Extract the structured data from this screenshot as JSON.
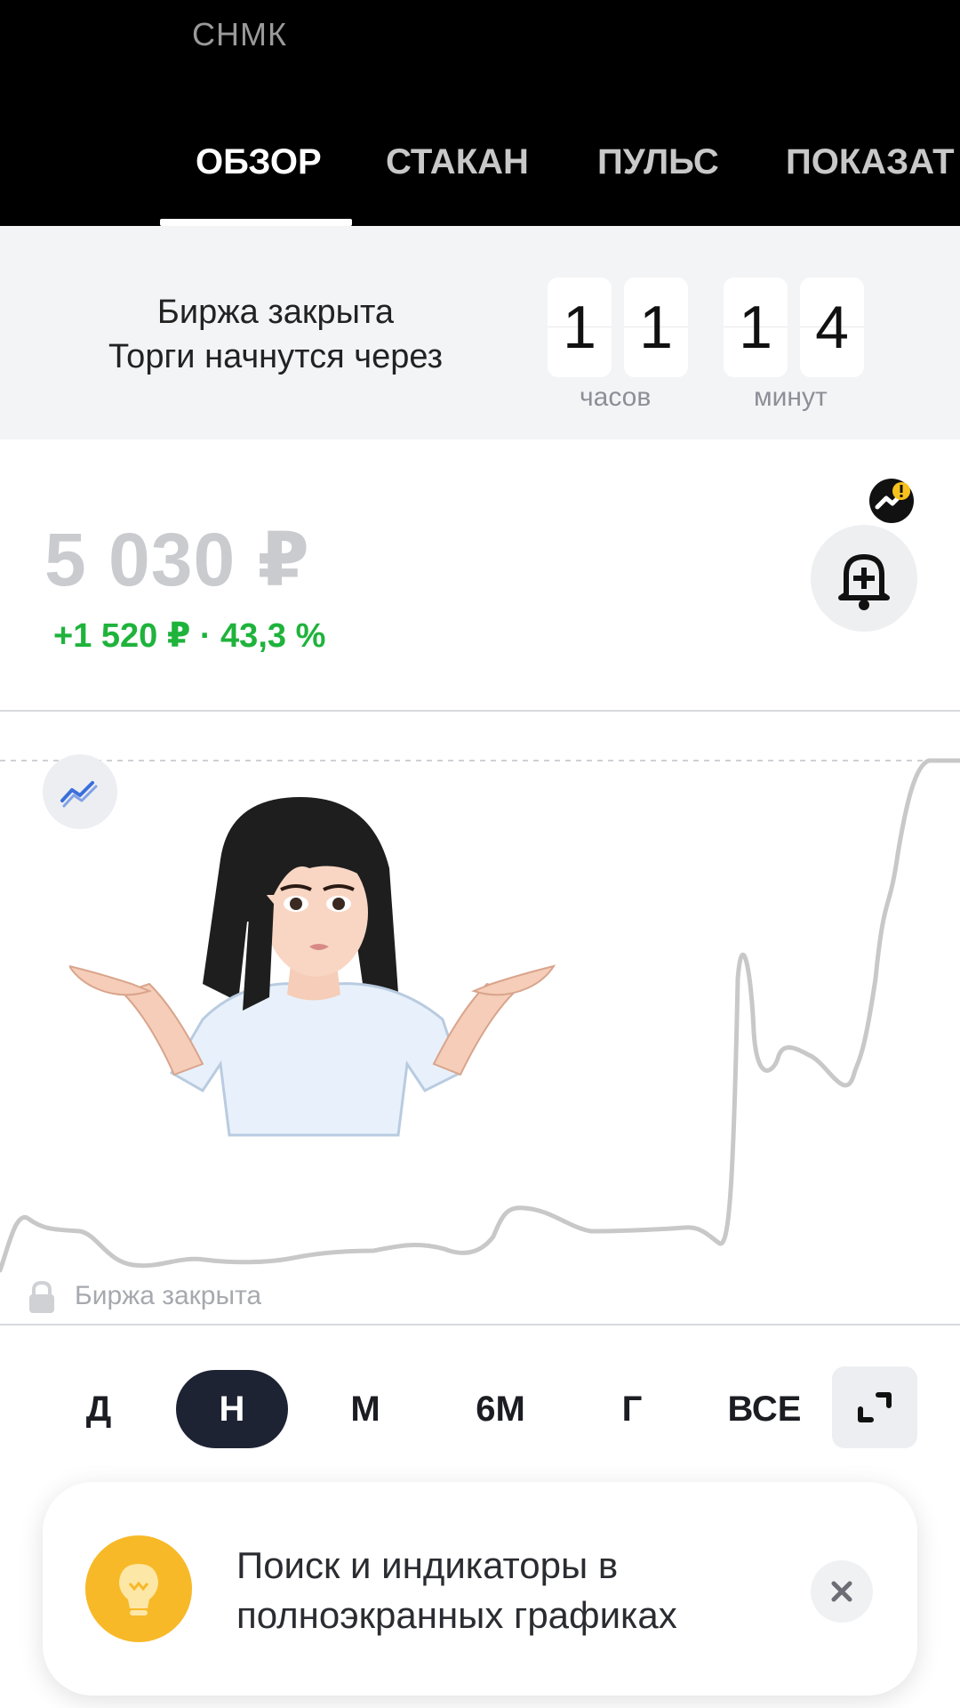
{
  "header": {
    "ticker": "СНМК",
    "tabs": [
      {
        "label": "ОБЗОР",
        "active": true
      },
      {
        "label": "СТАКАН",
        "active": false
      },
      {
        "label": "ПУЛЬС",
        "active": false
      },
      {
        "label": "ПОКАЗАТ",
        "active": false
      }
    ]
  },
  "exchange": {
    "line1": "Биржа закрыта",
    "line2": "Торги начнутся через",
    "hours_digits": [
      "1",
      "1"
    ],
    "minutes_digits": [
      "1",
      "4"
    ],
    "hours_label": "часов",
    "minutes_label": "минут"
  },
  "price": {
    "value": "5 030 ₽",
    "change": "+1 520 ₽ · 43,3 %",
    "change_color": "#1fb33c"
  },
  "chart": {
    "status_label": "Биржа закрыта",
    "line_color": "#c8c8c8"
  },
  "periods": [
    {
      "label": "Д",
      "active": false
    },
    {
      "label": "Н",
      "active": true
    },
    {
      "label": "М",
      "active": false
    },
    {
      "label": "6М",
      "active": false
    },
    {
      "label": "Г",
      "active": false
    },
    {
      "label": "ВСЕ",
      "active": false
    }
  ],
  "tip": {
    "text": "Поиск и индикаторы в полноэкранных графиках",
    "icon": "lightbulb-icon",
    "icon_color": "#f7b928"
  },
  "colors": {
    "accent_dark": "#1d2333",
    "background_band": "#f3f4f6"
  }
}
